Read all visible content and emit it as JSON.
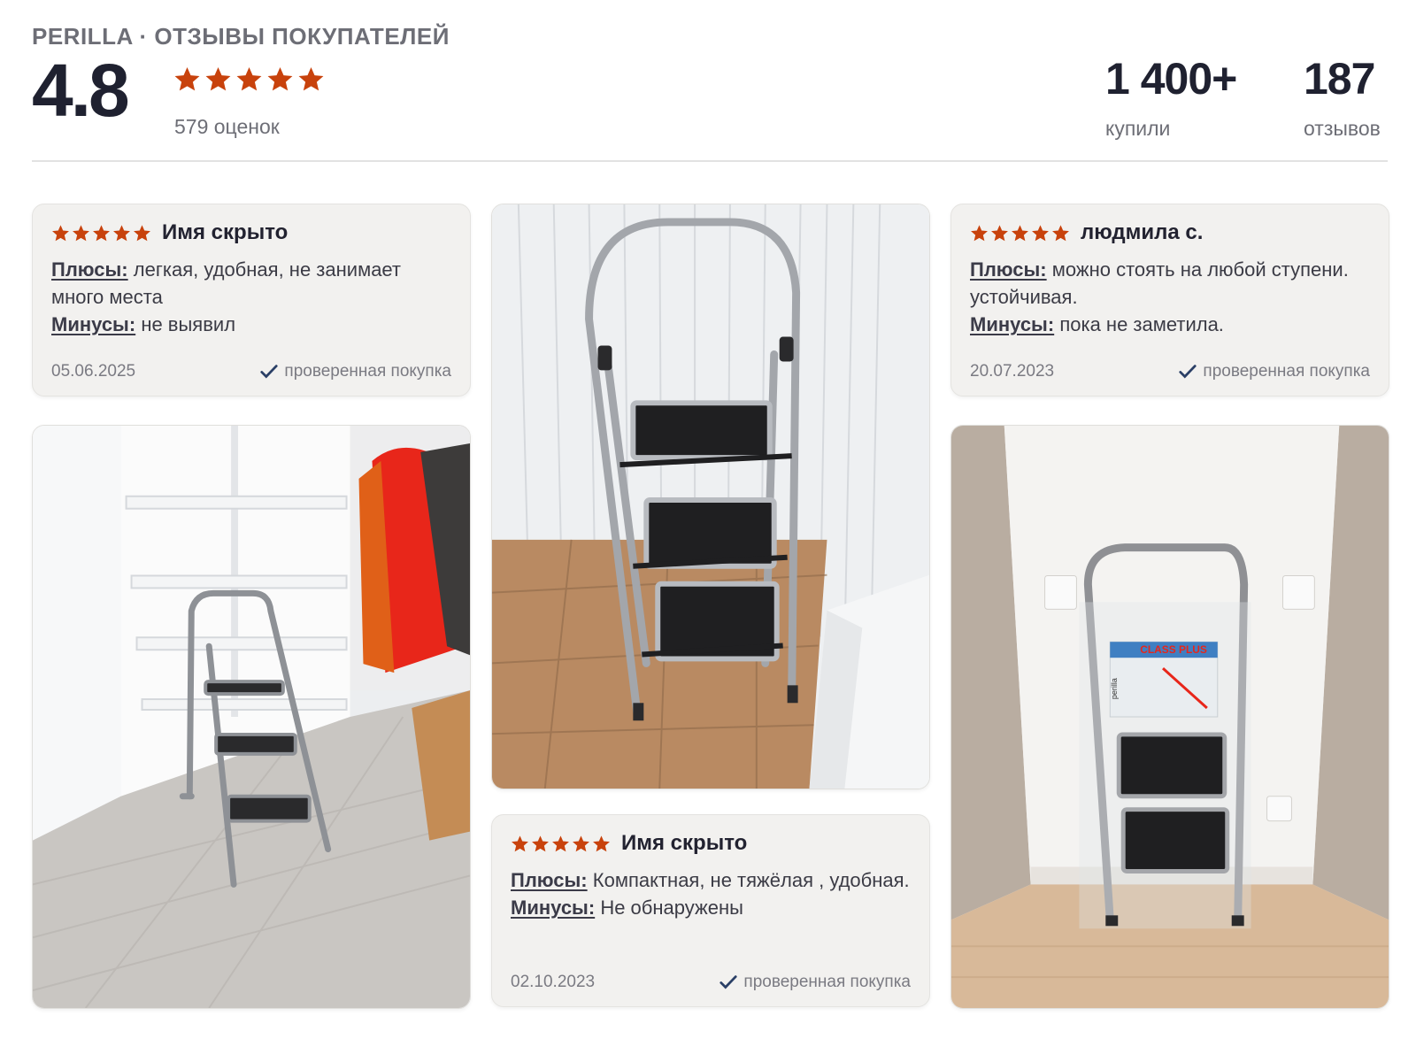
{
  "header": {
    "brand": "PERILLA · ОТЗЫВЫ ПОКУПАТЕЛЕЙ",
    "rating": "4.8",
    "rating_stars": 5,
    "rating_count": "579 оценок",
    "stats": [
      {
        "value": "1 400+",
        "label": "купили"
      },
      {
        "value": "187",
        "label": "отзывов"
      }
    ]
  },
  "colors": {
    "star": "#c8420c",
    "check": "#2a3f66",
    "card_bg": "#f2f1ef"
  },
  "reviews": [
    {
      "author": "Имя скрыто",
      "stars": 5,
      "pros_label": "Плюсы:",
      "pros": "легкая, удобная, не занимает много места",
      "cons_label": "Минусы:",
      "cons": "не выявил",
      "date": "05.06.2025",
      "verified": "проверенная покупка"
    },
    {
      "author": "людмила с.",
      "stars": 5,
      "pros_label": "Плюсы:",
      "pros": "можно стоять на любой ступени. устойчивая.",
      "cons_label": "Минусы:",
      "cons": "пока не заметила.",
      "date": "20.07.2023",
      "verified": "проверенная покупка"
    },
    {
      "author": "Имя скрыто",
      "stars": 5,
      "pros_label": "Плюсы:",
      "pros": "Компактная, не тяжёлая , удобная.",
      "cons_label": "Минусы:",
      "cons": "Не обнаружены",
      "date": "02.10.2023",
      "verified": "проверенная покупка"
    }
  ],
  "photos": {
    "photo_3_package_title": "CLASS PLUS",
    "photo_3_package_brand": "perilla"
  }
}
